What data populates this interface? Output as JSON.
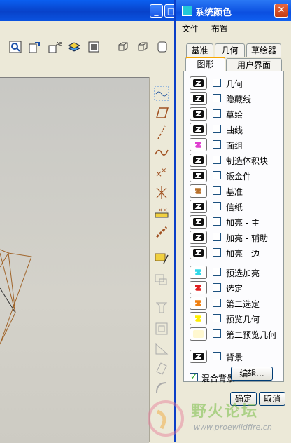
{
  "colors": {
    "titlebar": "#0b4fe0",
    "swatch_dark": "#111111",
    "magenta": "#e040d0",
    "bronze": "#b8702a",
    "cyan": "#30d8e8",
    "red": "#e02020",
    "orange": "#f08010",
    "yellow": "#ffee00",
    "pale_yellow": "#fff8d0"
  },
  "dialog": {
    "title": "系统颜色",
    "close_glyph": "✕",
    "menu": [
      "文件",
      "布置"
    ],
    "tabs_row1": [
      "基准",
      "几何",
      "草绘器"
    ],
    "tabs_row2": [
      "图形",
      "用户界面"
    ],
    "active_tab": "图形",
    "color_items": [
      {
        "label": "几何",
        "swatch": "dark",
        "checked": false
      },
      {
        "label": "隐藏线",
        "swatch": "dark",
        "checked": false
      },
      {
        "label": "草绘",
        "swatch": "dark",
        "checked": false
      },
      {
        "label": "曲线",
        "swatch": "dark",
        "checked": false
      },
      {
        "label": "面组",
        "swatch": "magenta",
        "checked": false
      },
      {
        "label": "制造体积块",
        "swatch": "dark",
        "checked": false
      },
      {
        "label": "钣金件",
        "swatch": "dark",
        "checked": false
      },
      {
        "label": "基准",
        "swatch": "bronze",
        "checked": false
      },
      {
        "label": "信纸",
        "swatch": "dark",
        "checked": false
      },
      {
        "label": "加亮 - 主",
        "swatch": "dark",
        "checked": false
      },
      {
        "label": "加亮 - 辅助",
        "swatch": "dark",
        "checked": false
      },
      {
        "label": "加亮 - 边",
        "swatch": "dark",
        "checked": false
      },
      {
        "label": "预选加亮",
        "swatch": "cyan",
        "checked": false
      },
      {
        "label": "选定",
        "swatch": "red",
        "checked": false
      },
      {
        "label": "第二选定",
        "swatch": "orange",
        "checked": false
      },
      {
        "label": "预览几何",
        "swatch": "yellow",
        "checked": false
      },
      {
        "label": "第二预览几何",
        "swatch": "pale_yellow",
        "checked": false
      },
      {
        "label": "背景",
        "swatch": "dark",
        "checked": false
      }
    ],
    "blend_background": {
      "label": "混合背景",
      "checked": true
    },
    "edit_button": "编辑...",
    "ok_button": "确定",
    "cancel_button": "取消"
  },
  "watermark": {
    "text": "野火论坛",
    "url": "www.proewildfire.cn"
  }
}
